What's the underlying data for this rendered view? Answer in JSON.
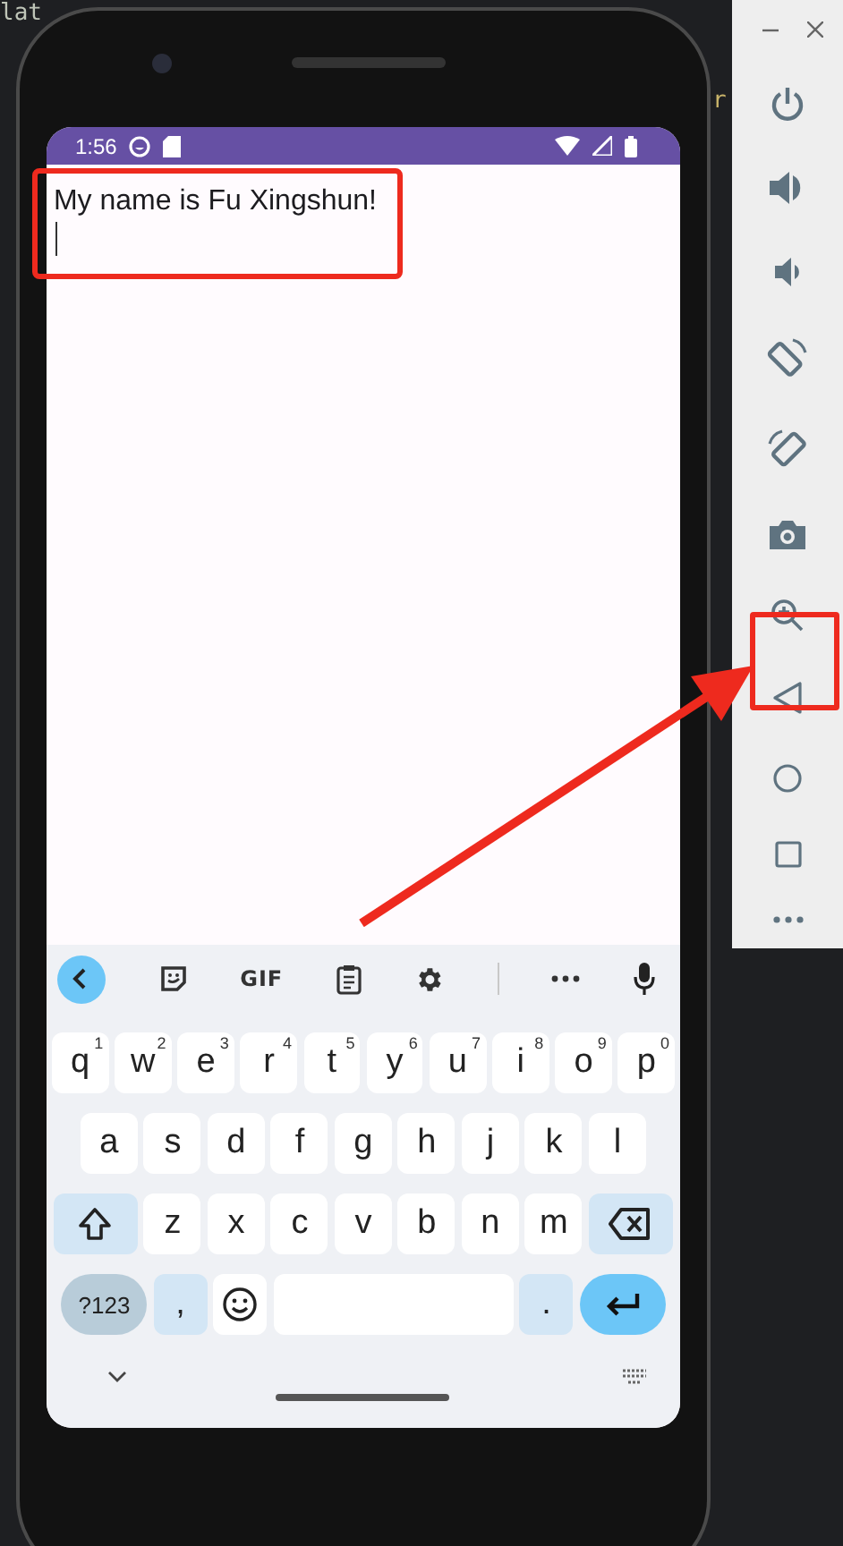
{
  "ide_fragments": [
    "lat",
    "r"
  ],
  "status_bar": {
    "time": "1:56"
  },
  "text_field": {
    "value": "My name is Fu Xingshun!"
  },
  "keyboard": {
    "toolbar_label": "GIF",
    "rows": [
      {
        "keys": [
          {
            "label": "q",
            "hint": "1"
          },
          {
            "label": "w",
            "hint": "2"
          },
          {
            "label": "e",
            "hint": "3"
          },
          {
            "label": "r",
            "hint": "4"
          },
          {
            "label": "t",
            "hint": "5"
          },
          {
            "label": "y",
            "hint": "6"
          },
          {
            "label": "u",
            "hint": "7"
          },
          {
            "label": "i",
            "hint": "8"
          },
          {
            "label": "o",
            "hint": "9"
          },
          {
            "label": "p",
            "hint": "0"
          }
        ]
      },
      {
        "keys": [
          {
            "label": "a"
          },
          {
            "label": "s"
          },
          {
            "label": "d"
          },
          {
            "label": "f"
          },
          {
            "label": "g"
          },
          {
            "label": "h"
          },
          {
            "label": "j"
          },
          {
            "label": "k"
          },
          {
            "label": "l"
          }
        ]
      },
      {
        "keys": [
          {
            "label": "z"
          },
          {
            "label": "x"
          },
          {
            "label": "c"
          },
          {
            "label": "v"
          },
          {
            "label": "b"
          },
          {
            "label": "n"
          },
          {
            "label": "m"
          }
        ]
      }
    ],
    "symbols_key": "?123",
    "comma_key": ",",
    "period_key": "."
  }
}
